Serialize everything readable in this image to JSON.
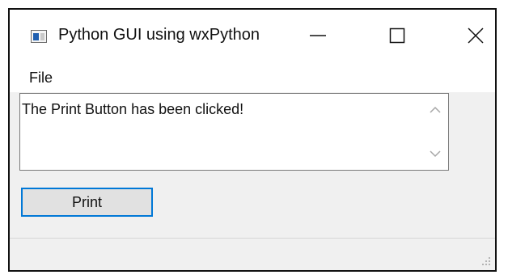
{
  "window": {
    "title": "Python GUI using wxPython",
    "icon": "app-window-icon",
    "controls": {
      "minimize_icon": "minimize-icon",
      "maximize_icon": "maximize-icon",
      "close_icon": "close-icon"
    }
  },
  "menubar": {
    "items": [
      {
        "label": "File"
      }
    ]
  },
  "textarea": {
    "value": "The Print Button has been clicked!"
  },
  "buttons": {
    "print_label": "Print"
  },
  "colors": {
    "focus_border": "#0078d7",
    "button_face": "#e1e1e1",
    "window_bg": "#f0f0f0"
  }
}
